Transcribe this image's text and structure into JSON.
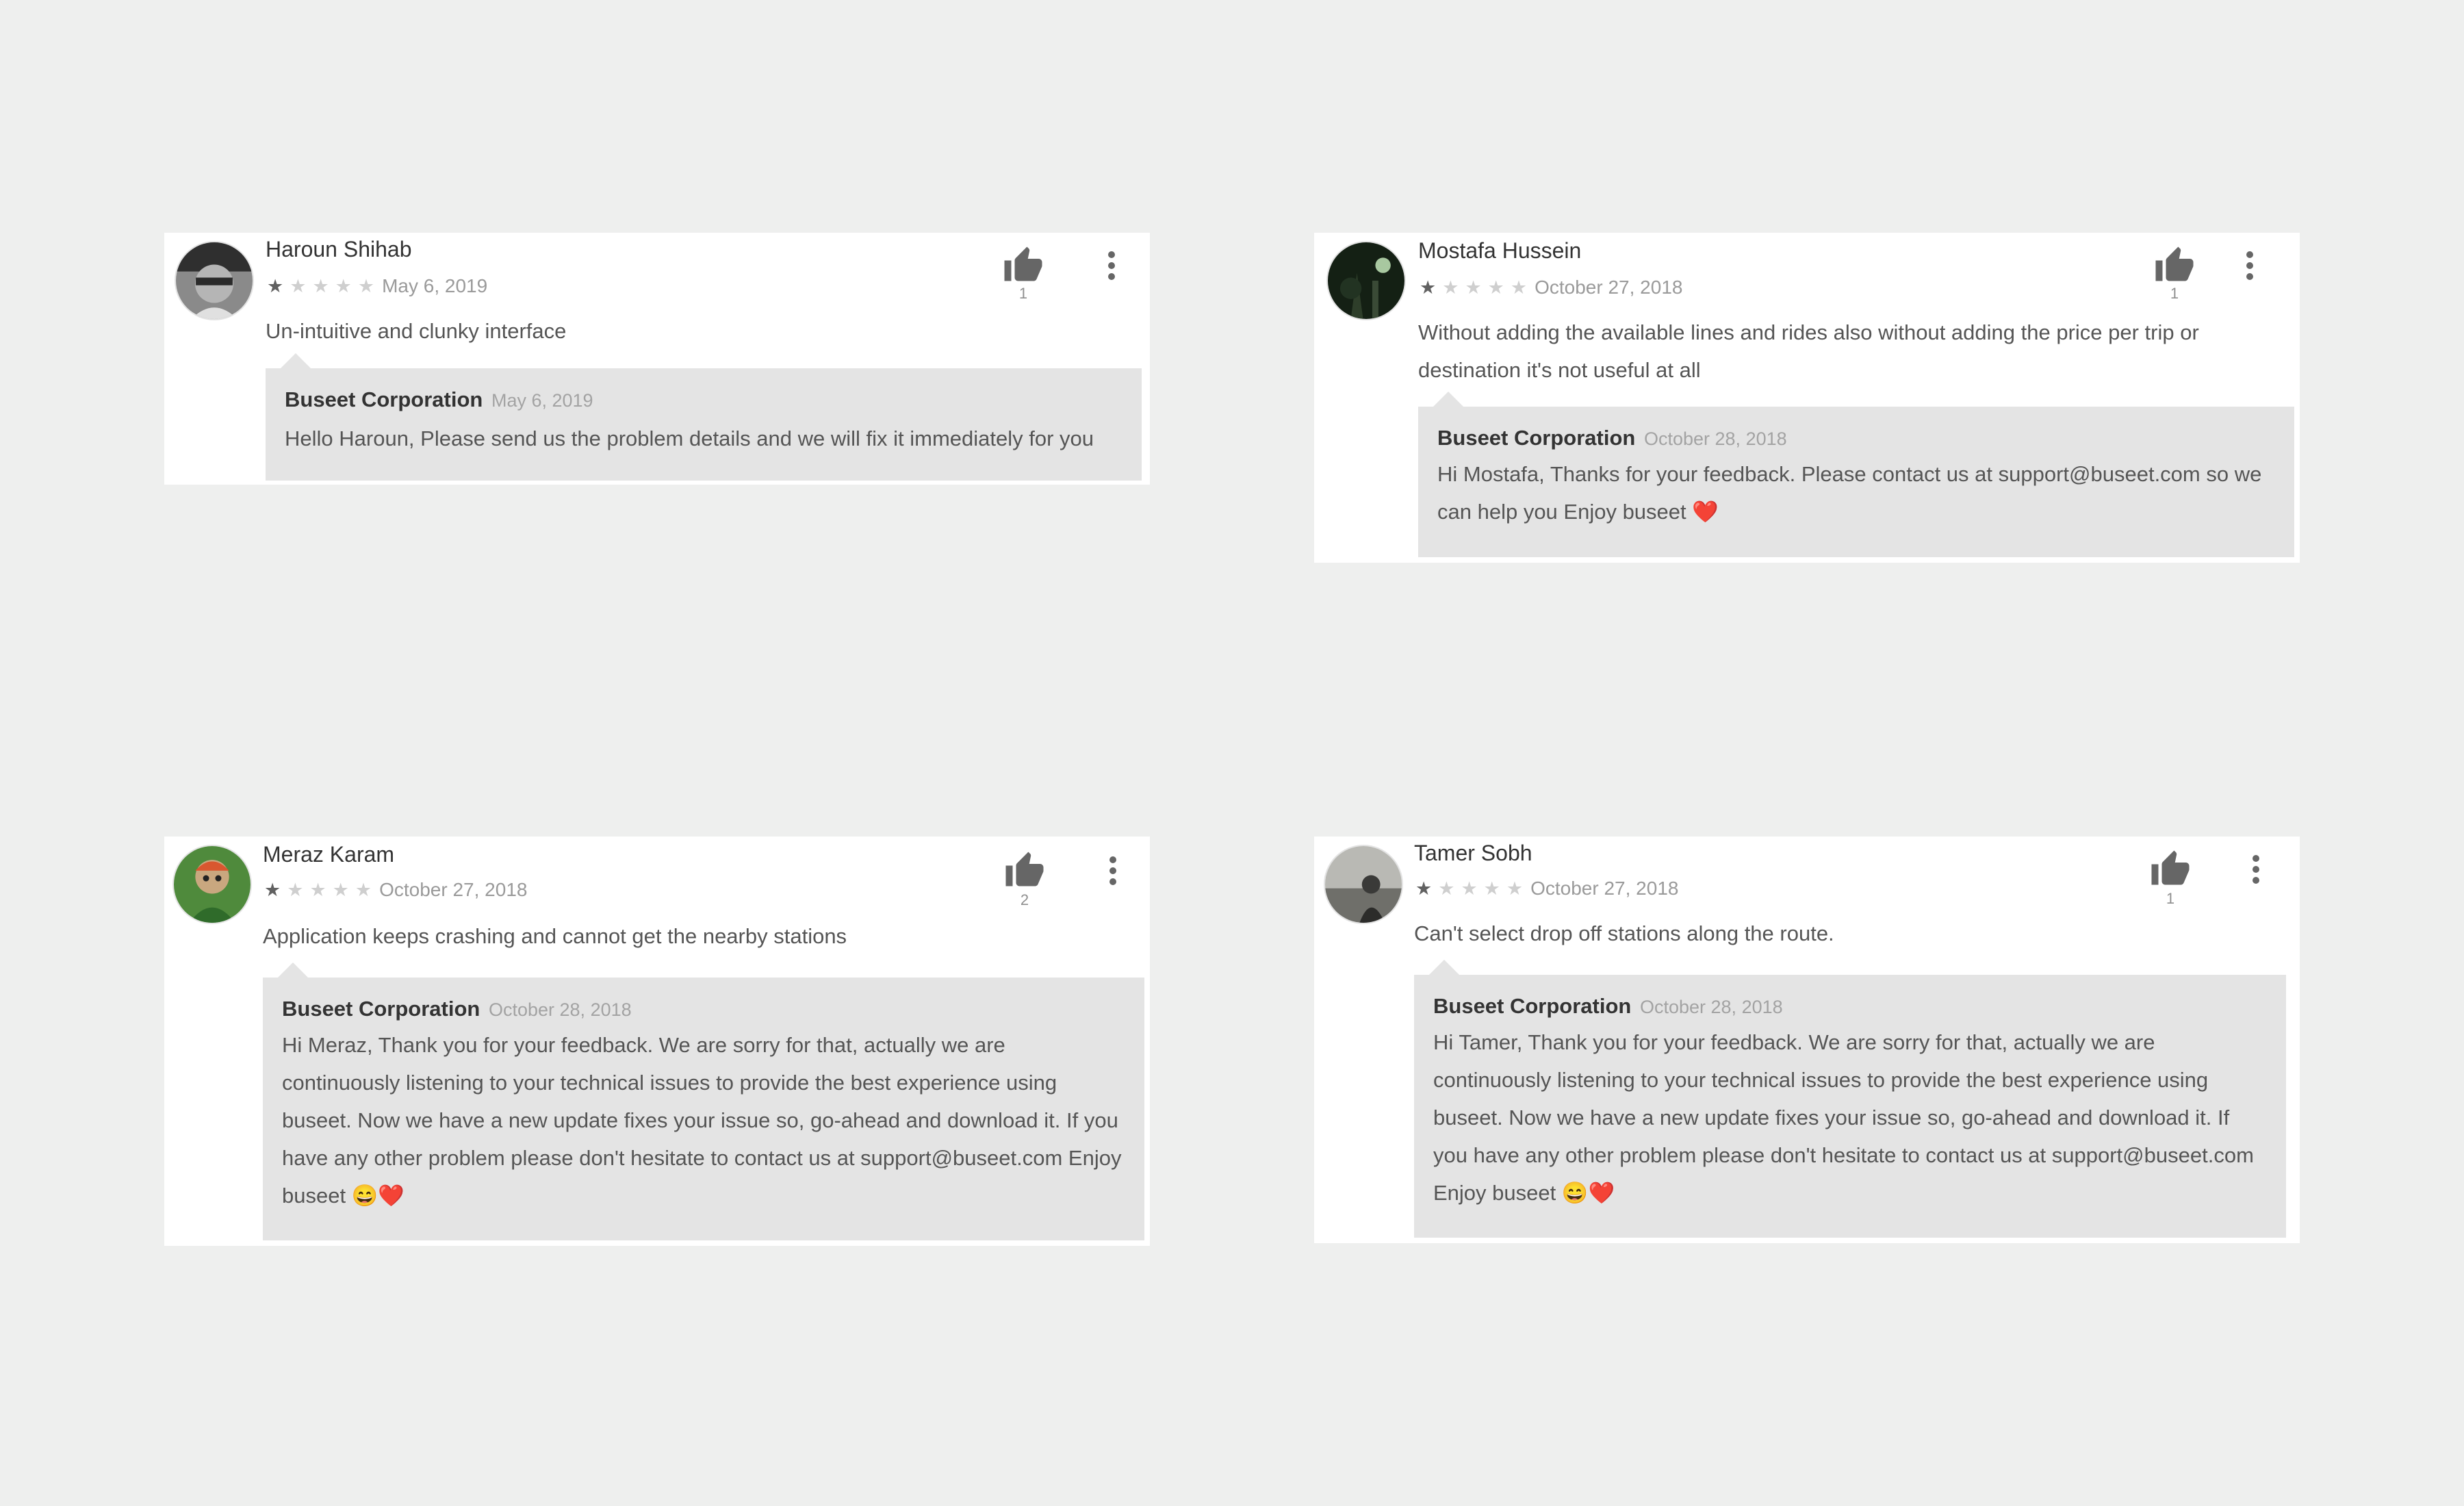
{
  "reviews": [
    {
      "author": "Haroun Shihab",
      "rating": 1,
      "max_rating": 5,
      "date": "May 6, 2019",
      "text": "Un-intuitive and clunky interface",
      "helpful_count": "1",
      "reply": {
        "developer": "Buseet Corporation",
        "date": "May 6, 2019",
        "text": "Hello Haroun, Please send us the problem details and we will fix it immediately for you"
      }
    },
    {
      "author": "Mostafa Hussein",
      "rating": 1,
      "max_rating": 5,
      "date": "October 27, 2018",
      "text": "Without adding the available lines and rides also without adding the price per trip or destination it's not useful at all",
      "helpful_count": "1",
      "reply": {
        "developer": "Buseet Corporation",
        "date": "October 28, 2018",
        "text": "Hi Mostafa, Thanks for your feedback. Please contact us at support@buseet.com so we can help you Enjoy buseet ❤️"
      }
    },
    {
      "author": "Meraz Karam",
      "rating": 1,
      "max_rating": 5,
      "date": "October 27, 2018",
      "text": "Application keeps crashing and cannot get the nearby stations",
      "helpful_count": "2",
      "reply": {
        "developer": "Buseet Corporation",
        "date": "October 28, 2018",
        "text": "Hi Meraz, Thank you for your feedback. We are sorry for that, actually we are continuously listening to your technical issues to provide the best experience using buseet. Now we have a new update fixes your issue so, go-ahead and download it. If you have any other problem please don't hesitate to contact us at support@buseet.com Enjoy buseet 😄❤️"
      }
    },
    {
      "author": "Tamer Sobh",
      "rating": 1,
      "max_rating": 5,
      "date": "October 27, 2018",
      "text": "Can't select drop off stations along the route.",
      "helpful_count": "1",
      "reply": {
        "developer": "Buseet Corporation",
        "date": "October 28, 2018",
        "text": "Hi Tamer, Thank you for your feedback. We are sorry for that, actually we are continuously listening to your technical issues to provide the best experience using buseet. Now we have a new update fixes your issue so, go-ahead and download it. If you have any other problem please don't hesitate to contact us at support@buseet.com Enjoy buseet 😄❤️"
      }
    }
  ],
  "icons": {
    "thumb": "thumb-up-icon",
    "menu": "more-vert-icon",
    "star": "star-icon"
  },
  "colors": {
    "background": "#eeefee",
    "card": "#ffffff",
    "reply_background": "#e4e4e4",
    "star_filled": "#616161",
    "star_empty": "#cfcfcf"
  }
}
